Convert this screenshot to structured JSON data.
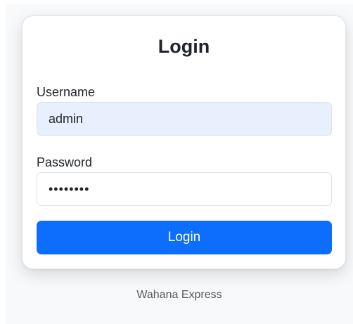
{
  "login_form": {
    "title": "Login",
    "username_label": "Username",
    "username_value": "admin",
    "password_label": "Password",
    "password_value": "password",
    "submit_label": "Login"
  },
  "footer": {
    "text": "Wahana Express"
  },
  "colors": {
    "primary": "#0d6efd",
    "autofill_background": "#e8f0fe",
    "page_background": "#f8f9fa"
  }
}
